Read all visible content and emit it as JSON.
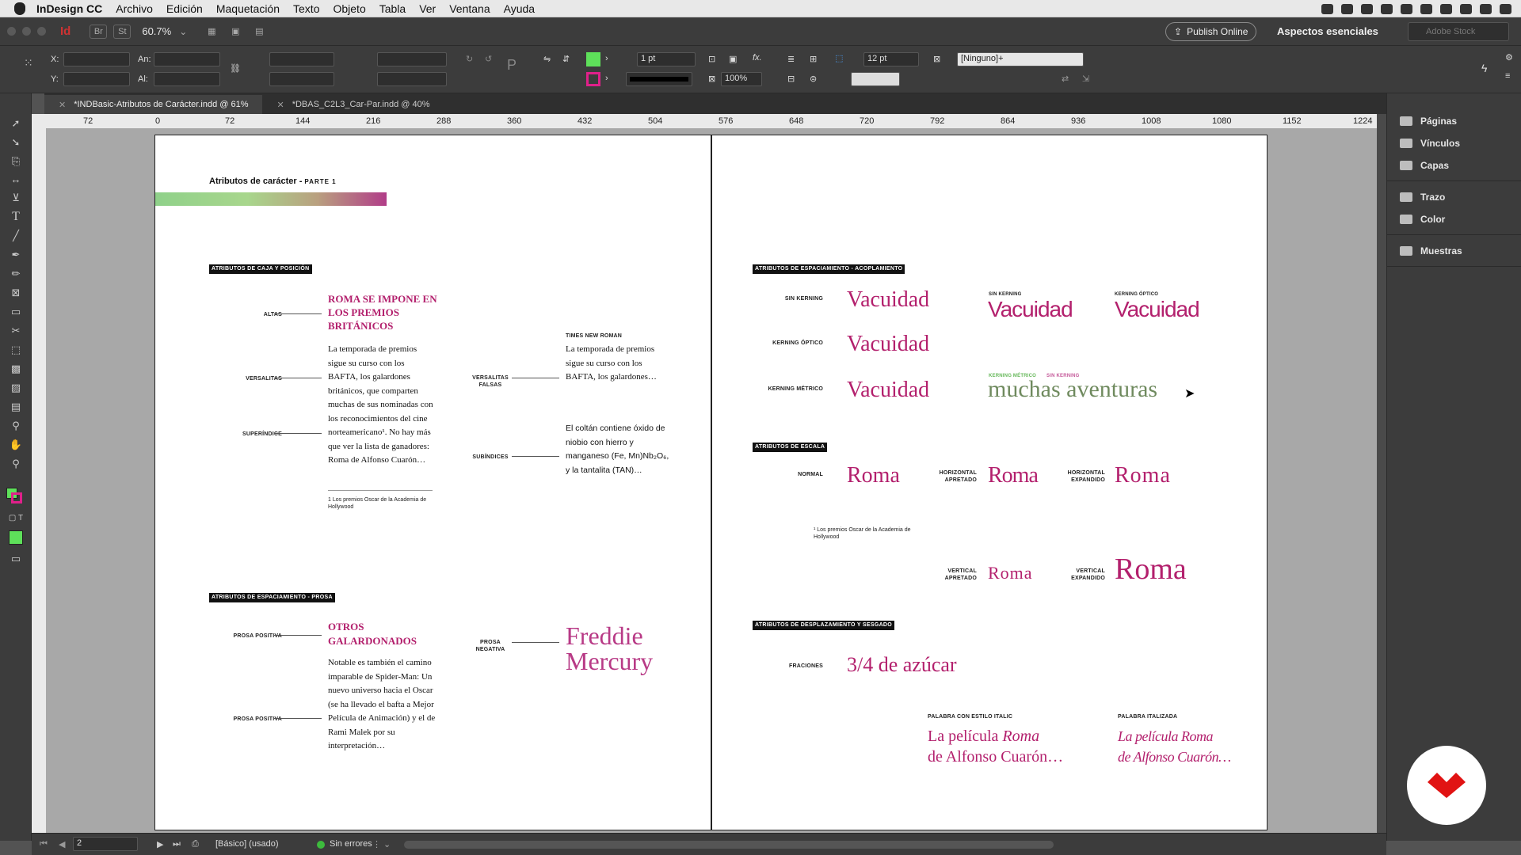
{
  "menubar": {
    "app_name": "InDesign CC",
    "items": [
      "Archivo",
      "Edición",
      "Maquetación",
      "Texto",
      "Objeto",
      "Tabla",
      "Ver",
      "Ventana",
      "Ayuda"
    ]
  },
  "appbar": {
    "zoom": "60.7%",
    "bridge_label": "Br",
    "stock_label": "St",
    "publish_label": "Publish Online",
    "workspace": "Aspectos esenciales",
    "search_placeholder": "Adobe Stock"
  },
  "controlbar": {
    "x_label": "X:",
    "y_label": "Y:",
    "w_label": "An:",
    "h_label": "Al:",
    "stroke_weight": "1 pt",
    "opacity": "100%",
    "gutter": "12 pt",
    "object_style": "[Ninguno]+",
    "fill_color": "#5ee05a",
    "stroke_color": "#e0208a"
  },
  "tabs": [
    {
      "label": "*INDBasic-Atributos de Carácter.indd @ 61%"
    },
    {
      "label": "*DBAS_C2L3_Car-Par.indd @ 40%"
    }
  ],
  "ruler": {
    "h_ticks": [
      "72",
      "0",
      "72",
      "144",
      "216",
      "288",
      "360",
      "432",
      "504",
      "576",
      "648",
      "720",
      "792",
      "864",
      "936",
      "1008",
      "1080",
      "1152",
      "1224"
    ]
  },
  "page_left": {
    "header_title": "Atributos de carácter - ",
    "header_part": "PARTE 1",
    "sec1_tag": "ATRIBUTOS DE CAJA Y POSICIÓN",
    "altas_label": "ALTAS",
    "altas_text": "ROMA SE IMPONE EN LOS PREMIOS BRITÁNICOS",
    "versalitas_label": "VERSALITAS",
    "superindice_label": "SUPERÍNDICE",
    "body1": "La temporada de premios sigue su curso con los BAFTA, los galardones británicos, que comparten muchas de sus nominadas con los reconocimientos del cine norteamericano¹. No hay más que ver la lista de ganadores: Roma de Alfonso Cuarón…",
    "footnote1": "1 Los premios Oscar de la Academia de Hollywood",
    "tnr_label": "TIMES NEW ROMAN",
    "versalitas_falsas_label": "VERSALITAS FALSAS",
    "body2": "La temporada de premios sigue su curso con los BAFTA, los galardones…",
    "subindices_label": "SUBÍNDICES",
    "body3": "El coltán contiene óxido de niobio con hierro y manganeso (Fe, Mn)Nb₂O₆, y la tantalita (TAN)…",
    "sec2_tag": "ATRIBUTOS DE ESPACIAMIENTO - PROSA",
    "prosa_positiva_label_1": "PROSA POSITIVA",
    "prosa_positiva_label_2": "PROSA  POSITIVA",
    "otros_text": "OTROS GALARDONADOS",
    "body4": "Notable es también el camino imparable de Spider-Man: Un nuevo universo hacia el Oscar (se ha llevado el bafta a Mejor Película de Animación) y el de Rami Malek por su interpretación…",
    "prosa_negativa_label": "PROSA NEGATIVA",
    "freddie": "Freddie Mercury"
  },
  "page_right": {
    "sec1_tag": "ATRIBUTOS DE ESPACIAMIENTO - ACOPLAMIENTO",
    "sin_kerning_label": "SIN KERNING",
    "kerning_optico_label": "KERNING ÓPTICO",
    "kerning_metrico_label": "KERNING MÉTRICO",
    "sin_kerning_label_small": "SIN KERNING",
    "kerning_optico_label_small": "KERNING ÓPTICO",
    "word_vacuidad": "Vacuidad",
    "km_small": "KERNING MÉTRICO",
    "sk_small": "SIN KERNING",
    "muchas": "muchas aventuras",
    "sec2_tag": "ATRIBUTOS DE ESCALA",
    "normal_label": "NORMAL",
    "h_apretado_label": "HORIZONTAL APRETADO",
    "h_expandido_label": "HORIZONTAL EXPANDIDO",
    "roma": "Roma",
    "footnote": "¹ Los premios Oscar de la Academia de Hollywood",
    "v_apretado_label": "VERTICAL APRETADO",
    "v_expandido_label": "VERTICAL EXPANDIDO",
    "sec3_tag": "ATRIBUTOS DE DESPLAZAMIENTO Y SESGADO",
    "fraciones_label": "FRACIONES",
    "fraction_text": "3/4 de azúcar",
    "italic_label": "PALABRA CON ESTILO ITALIC",
    "italizada_label": "PALABRA ITALIZADA",
    "pelicula_1": "La película ",
    "pelicula_roma": "Roma",
    "pelicula_2": "de Alfonso Cuarón…",
    "pelicula_b1": "La película Roma",
    "pelicula_b2": "de Alfonso Cuarón…"
  },
  "right_panel": {
    "items": [
      "Páginas",
      "Vínculos",
      "Capas",
      "Trazo",
      "Color",
      "Muestras"
    ]
  },
  "statusbar": {
    "page_number": "2",
    "style": "[Básico] (usado)",
    "errors": "Sin errores"
  }
}
